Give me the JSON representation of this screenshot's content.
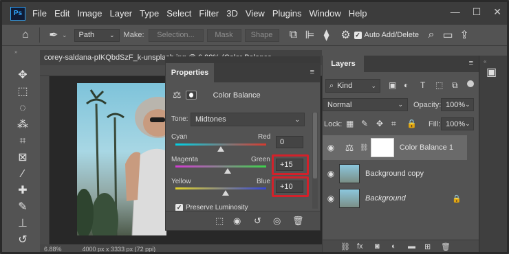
{
  "app": {
    "logo": "Ps"
  },
  "menu": [
    "File",
    "Edit",
    "Image",
    "Layer",
    "Type",
    "Select",
    "Filter",
    "3D",
    "View",
    "Plugins",
    "Window",
    "Help"
  ],
  "window_controls": {
    "minimize": "—",
    "restore": "☐",
    "close": "✕"
  },
  "options_bar": {
    "path_mode": "Path",
    "make_label": "Make:",
    "selection_btn": "Selection...",
    "mask_btn": "Mask",
    "shape_btn": "Shape",
    "auto_add_delete": "Auto Add/Delete"
  },
  "document": {
    "tab_title": "corey-saldana-pIKQbdSzF_k-unsplash.jpg @ 6.88% (Color Balance",
    "zoom": "6.88%",
    "doc_size": "4000 px x 3333 px (72 ppi)"
  },
  "properties": {
    "tab": "Properties",
    "adjustment_name": "Color Balance",
    "tone_label": "Tone:",
    "tone_value": "Midtones",
    "sliders": [
      {
        "left": "Cyan",
        "right": "Red",
        "value": "0",
        "level": 0
      },
      {
        "left": "Magenta",
        "right": "Green",
        "value": "+15",
        "level": 15
      },
      {
        "left": "Yellow",
        "right": "Blue",
        "value": "+10",
        "level": 10
      }
    ],
    "preserve_luminosity": "Preserve Luminosity"
  },
  "layers": {
    "tab": "Layers",
    "filter_kind": "Kind",
    "blend_mode": "Normal",
    "opacity_label": "Opacity:",
    "opacity_value": "100%",
    "lock_label": "Lock:",
    "fill_label": "Fill:",
    "fill_value": "100%",
    "items": [
      {
        "name": "Color Balance 1"
      },
      {
        "name": "Background copy"
      },
      {
        "name": "Background"
      }
    ]
  },
  "colors": {
    "highlight_box": "#d3212a",
    "panel_bg": "#535353",
    "menubar_bg": "#3c3c3c"
  }
}
